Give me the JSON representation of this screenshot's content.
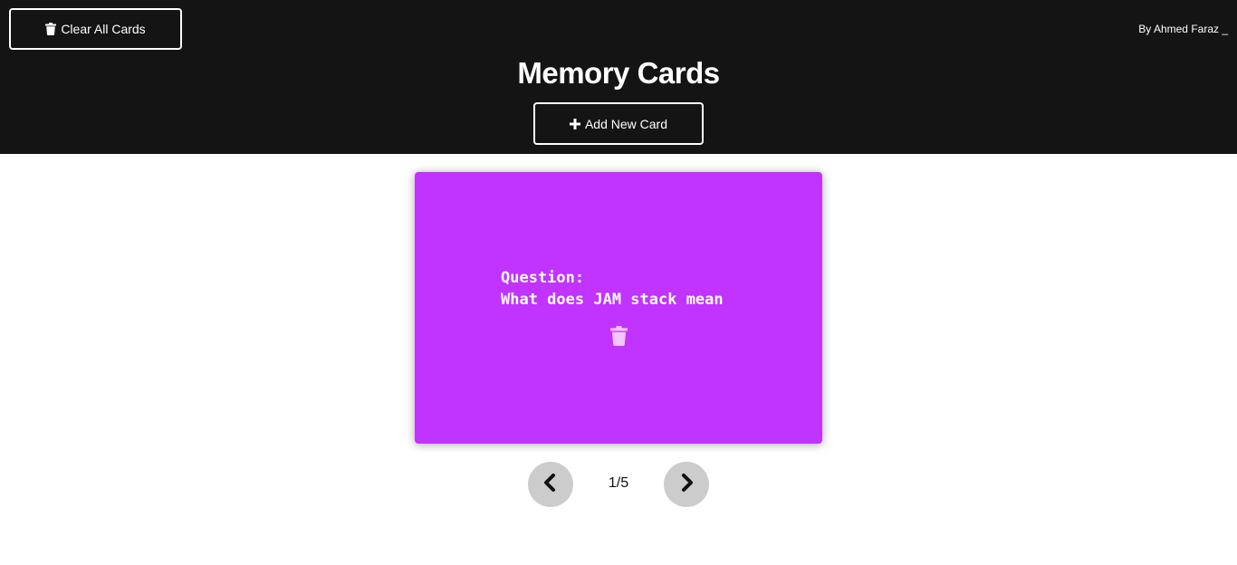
{
  "header": {
    "clear_button_label": "Clear All Cards",
    "clear_button_icon": "trash-icon",
    "author_text": "By Ahmed Faraz _",
    "title": "Memory Cards",
    "add_button_label": "Add New Card",
    "add_button_icon": "plus-icon"
  },
  "card": {
    "label": "Question:",
    "text": "What does JAM stack mean",
    "delete_icon": "trash-icon",
    "color": "#c133ff"
  },
  "navigation": {
    "prev_icon": "chevron-left-icon",
    "next_icon": "chevron-right-icon",
    "counter": "1/5"
  },
  "colors": {
    "header_background": "#141414",
    "card_background": "#c133ff",
    "nav_button_background": "#cccccc"
  }
}
